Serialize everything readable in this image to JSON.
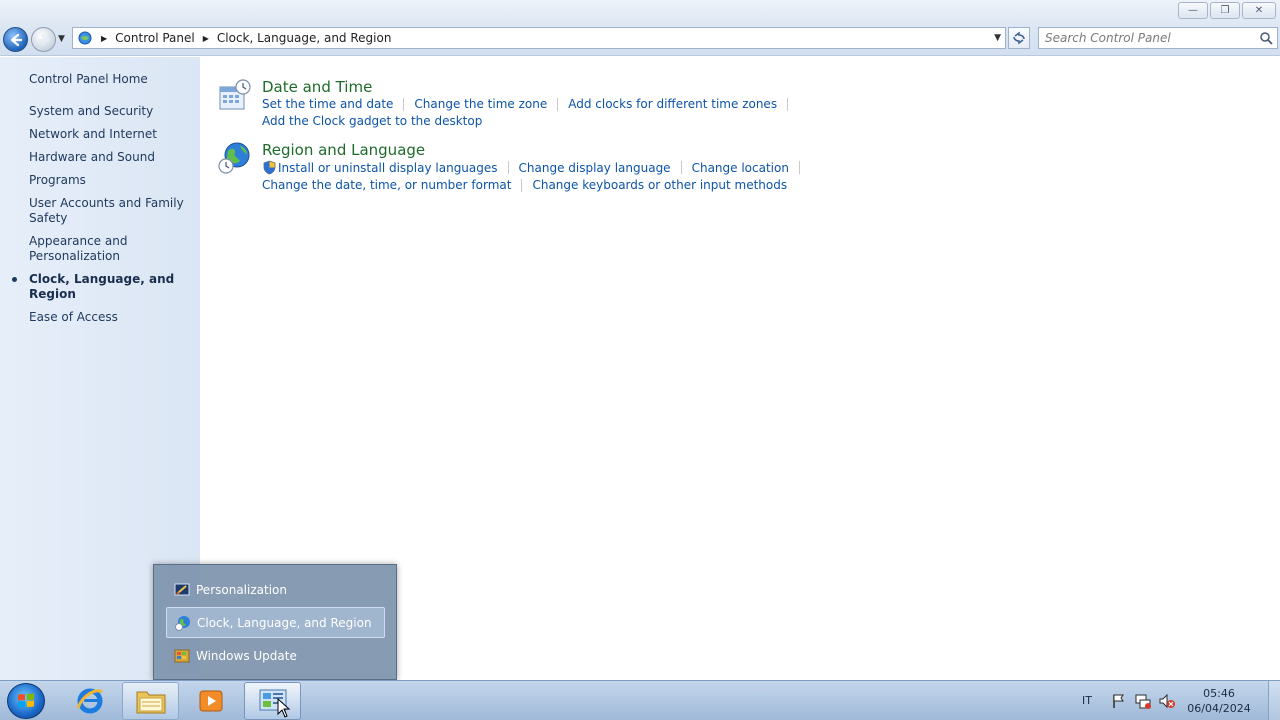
{
  "window": {
    "minimize_icon": "minimize-icon",
    "maximize_icon": "restore-icon",
    "close_icon": "close-icon"
  },
  "address": {
    "crumbs": [
      "Control Panel",
      "Clock, Language, and Region"
    ],
    "search_placeholder": "Search Control Panel"
  },
  "sidebar": {
    "home": "Control Panel Home",
    "items": [
      {
        "label": "System and Security"
      },
      {
        "label": "Network and Internet"
      },
      {
        "label": "Hardware and Sound"
      },
      {
        "label": "Programs"
      },
      {
        "label": "User Accounts and Family Safety"
      },
      {
        "label": "Appearance and Personalization"
      },
      {
        "label": "Clock, Language, and Region"
      },
      {
        "label": "Ease of Access"
      }
    ]
  },
  "categories": [
    {
      "title": "Date and Time",
      "rows": [
        [
          "Set the time and date",
          "Change the time zone",
          "Add clocks for different time zones"
        ],
        [
          "Add the Clock gadget to the desktop"
        ]
      ]
    },
    {
      "title": "Region and Language",
      "rows": [
        [
          "Install or uninstall display languages",
          "Change display language",
          "Change location"
        ],
        [
          "Change the date, time, or number format",
          "Change keyboards or other input methods"
        ]
      ]
    }
  ],
  "jumplist": {
    "items": [
      {
        "label": "Personalization"
      },
      {
        "label": "Clock, Language, and Region"
      },
      {
        "label": "Windows Update"
      }
    ]
  },
  "taskbar": {
    "language": "IT",
    "time": "05:46",
    "date": "06/04/2024"
  }
}
